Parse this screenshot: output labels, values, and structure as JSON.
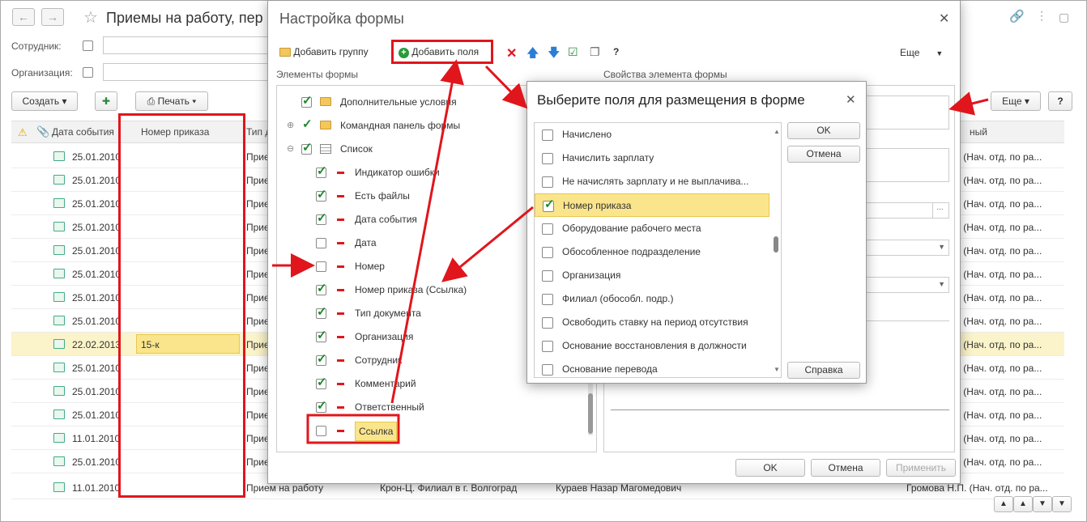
{
  "main_window": {
    "title": "Приемы на работу, пер",
    "filters": {
      "employee_label": "Сотрудник:",
      "organization_label": "Организация:"
    },
    "toolbar": {
      "create_label": "Создать",
      "print_label": "Печать",
      "more_label": "Еще",
      "help_label": "?"
    },
    "columns": {
      "date": "Дата события",
      "order_number": "Номер приказа",
      "type": "Тип д",
      "responsible": "ный"
    },
    "rows": [
      {
        "date": "25.01.2010",
        "order": "",
        "type": "Прие",
        "responsible": "П. (Нач. отд. по ра..."
      },
      {
        "date": "25.01.2010",
        "order": "",
        "type": "Прие",
        "responsible": "П. (Нач. отд. по ра..."
      },
      {
        "date": "25.01.2010",
        "order": "",
        "type": "Прие",
        "responsible": "П. (Нач. отд. по ра..."
      },
      {
        "date": "25.01.2010",
        "order": "",
        "type": "Прие",
        "responsible": "П. (Нач. отд. по ра..."
      },
      {
        "date": "25.01.2010",
        "order": "",
        "type": "Прие",
        "responsible": "П. (Нач. отд. по ра..."
      },
      {
        "date": "25.01.2010",
        "order": "",
        "type": "Прие",
        "responsible": "П. (Нач. отд. по ра..."
      },
      {
        "date": "25.01.2010",
        "order": "",
        "type": "Прие",
        "responsible": "П. (Нач. отд. по ра..."
      },
      {
        "date": "25.01.2010",
        "order": "",
        "type": "Прие",
        "responsible": "П. (Нач. отд. по ра..."
      },
      {
        "date": "22.02.2013",
        "order": "15-к",
        "type": "Прие",
        "responsible": "П. (Нач. отд. по ра..."
      },
      {
        "date": "25.01.2010",
        "order": "",
        "type": "Прие",
        "responsible": "П. (Нач. отд. по ра..."
      },
      {
        "date": "25.01.2010",
        "order": "",
        "type": "Прие",
        "responsible": "П. (Нач. отд. по ра..."
      },
      {
        "date": "25.01.2010",
        "order": "",
        "type": "Прие",
        "responsible": "П. (Нач. отд. по ра..."
      },
      {
        "date": "11.01.2010",
        "order": "",
        "type": "Прие",
        "responsible": "П. (Нач. отд. по ра..."
      },
      {
        "date": "25.01.2010",
        "order": "",
        "type": "Прие",
        "responsible": "П. (Нач. отд. по ра..."
      }
    ],
    "last_row": {
      "date": "11.01.2010",
      "type": "Прием на работу",
      "branch": "Крон-Ц. Филиал в г. Волгоград",
      "employee": "Кураев Назар Магомедович",
      "responsible": "Громова Н.П. (Нач. отд. по ра..."
    }
  },
  "settings_dialog": {
    "title": "Настройка формы",
    "add_group_label": "Добавить группу",
    "add_fields_label": "Добавить поля",
    "more_label": "Еще",
    "help_label": "?",
    "elements_label": "Элементы формы",
    "properties_label": "Свойства элемента формы",
    "tree": [
      {
        "label": "Дополнительные условия",
        "checked": true,
        "kind": "folder"
      },
      {
        "label": "Командная панель формы",
        "checked": true,
        "kind": "folder"
      },
      {
        "label": "Список",
        "checked": true,
        "kind": "table"
      },
      {
        "label": "Индикатор ошибки",
        "checked": true,
        "kind": "field"
      },
      {
        "label": "Есть файлы",
        "checked": true,
        "kind": "field"
      },
      {
        "label": "Дата события",
        "checked": true,
        "kind": "field"
      },
      {
        "label": "Дата",
        "checked": false,
        "kind": "field"
      },
      {
        "label": "Номер",
        "checked": false,
        "kind": "field"
      },
      {
        "label": "Номер приказа (Ссылка)",
        "checked": true,
        "kind": "field"
      },
      {
        "label": "Тип документа",
        "checked": true,
        "kind": "field"
      },
      {
        "label": "Организация",
        "checked": true,
        "kind": "field"
      },
      {
        "label": "Сотрудник",
        "checked": true,
        "kind": "field"
      },
      {
        "label": "Комментарий",
        "checked": true,
        "kind": "field"
      },
      {
        "label": "Ответственный",
        "checked": true,
        "kind": "field"
      },
      {
        "label": "Ссылка",
        "checked": false,
        "kind": "field"
      }
    ],
    "ok_label": "OK",
    "cancel_label": "Отмена",
    "apply_label": "Применить"
  },
  "fields_dialog": {
    "title": "Выберите поля для размещения в форме",
    "items": [
      {
        "label": "Начислено",
        "checked": false
      },
      {
        "label": "Начислить зарплату",
        "checked": false
      },
      {
        "label": "Не начислять зарплату и не выплачива...",
        "checked": false
      },
      {
        "label": "Номер приказа",
        "checked": true
      },
      {
        "label": "Оборудование рабочего места",
        "checked": false
      },
      {
        "label": "Обособленное подразделение",
        "checked": false
      },
      {
        "label": "Организация",
        "checked": false
      },
      {
        "label": "Филиал (обособл. подр.)",
        "checked": false
      },
      {
        "label": "Освободить ставку на период отсутствия",
        "checked": false
      },
      {
        "label": "Основание восстановления в должности",
        "checked": false
      },
      {
        "label": "Основание перевода",
        "checked": false
      }
    ],
    "ok_label": "OK",
    "cancel_label": "Отмена",
    "help_label": "Справка"
  },
  "colors": {
    "accent_red": "#e0161c",
    "highlight": "#fbe58c",
    "check_green": "#1a8a2a"
  }
}
